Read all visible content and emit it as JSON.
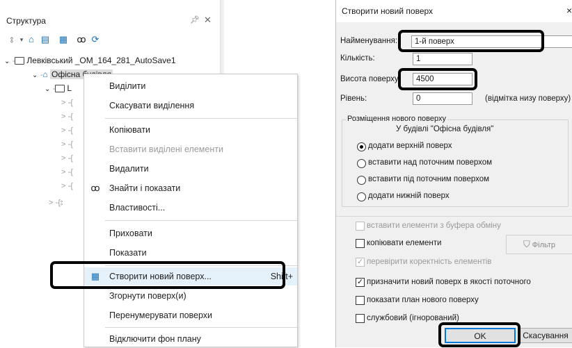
{
  "structure_panel": {
    "title": "Структура",
    "tree": {
      "project": "Левківський _OM_164_281_AutoSave1",
      "building": "Офісна будівля",
      "floor_label": "L"
    }
  },
  "context_menu": {
    "items": [
      {
        "label": "Виділити"
      },
      {
        "label": "Скасувати виділення"
      },
      {
        "label": "Копіювати"
      },
      {
        "label": "Вставити виділені елементи"
      },
      {
        "label": "Видалити"
      },
      {
        "label": "Знайти і показати"
      },
      {
        "label": "Властивості..."
      },
      {
        "label": "Приховати"
      },
      {
        "label": "Показати"
      },
      {
        "label": "Створити новий поверх...",
        "shortcut": "Shift+"
      },
      {
        "label": "Згорнути поверх(и)"
      },
      {
        "label": "Перенумерувати поверхи"
      },
      {
        "label": "Відключити фон плану"
      }
    ]
  },
  "dialog": {
    "title": "Створити новий поверх",
    "fields": {
      "name_label": "Найменування:",
      "name_value": "1-й поверх",
      "count_label": "Кількість:",
      "count_value": "1",
      "height_label": "Висота поверху:",
      "height_value": "4500",
      "level_label": "Рівень:",
      "level_value": "0",
      "level_note": "(відмітка низу поверху)"
    },
    "placement": {
      "group_title": "Розміщення нового поверху",
      "subtitle": "У будівлі \"Офісна будівля\"",
      "options": [
        {
          "label": "додати верхній поверх",
          "selected": true
        },
        {
          "label": "вставити над поточним поверхом",
          "selected": false
        },
        {
          "label": "вставити під поточним поверхом",
          "selected": false
        },
        {
          "label": "додати нижній поверх",
          "selected": false
        }
      ]
    },
    "checkboxes": {
      "paste_clipboard": "вставити елементи з буфера обміну",
      "copy_elements": "копіювати елементи",
      "check_correctness": "перевірити коректність елементів",
      "set_current": "призначити новий поверх в якості поточного",
      "show_plan": "показати план нового поверху",
      "service": "службовий (ігнорований)"
    },
    "filter_label": "Фільтр",
    "ok_label": "OK",
    "cancel_label": "Скасування"
  }
}
